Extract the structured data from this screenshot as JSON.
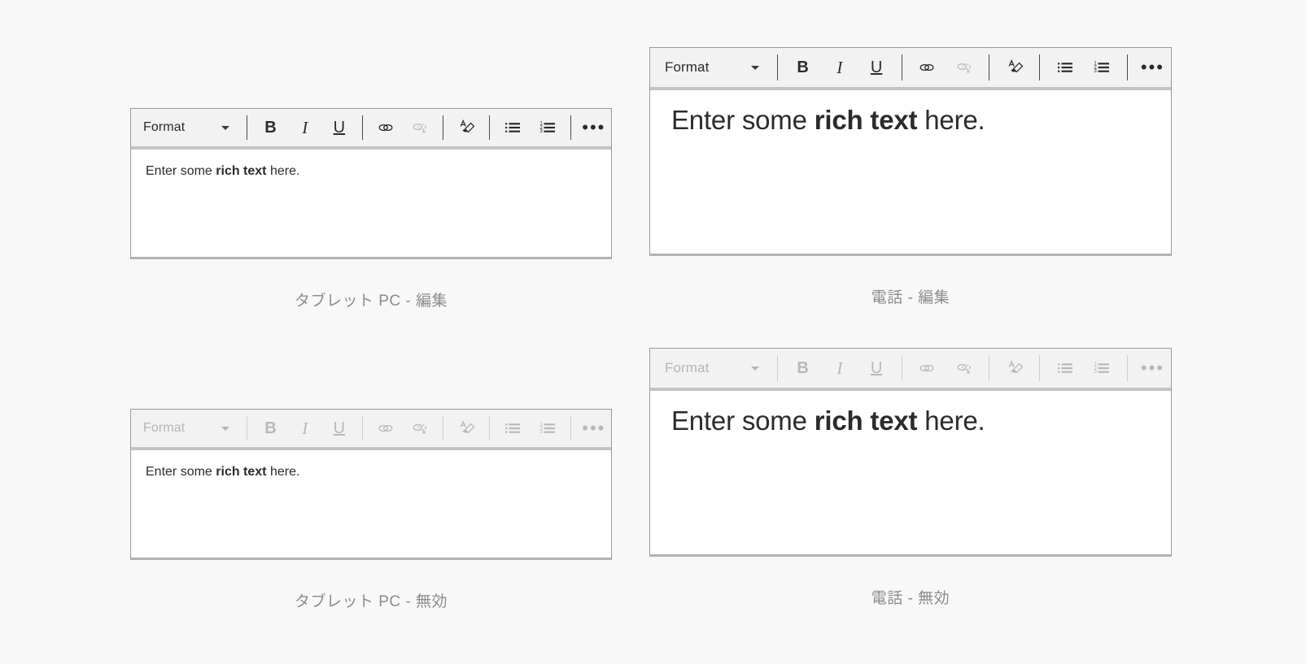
{
  "page": {
    "background_color": "#f8f8f8",
    "caption_color": "#8c8c8c",
    "text_color": "#2b2b2b",
    "toolbar_color": "#f2f2f2",
    "border_color": "#9a9a9a",
    "disabled_color": "#b8b8b8"
  },
  "toolbar": {
    "format_label": "Format",
    "format_dropdown_icon": "chevron-down-icon",
    "buttons": [
      {
        "name": "bold-button",
        "label": "B",
        "icon": "bold-icon"
      },
      {
        "name": "italic-button",
        "label": "I",
        "icon": "italic-icon"
      },
      {
        "name": "underline-button",
        "label": "U",
        "icon": "underline-icon"
      },
      {
        "name": "insert-link-button",
        "label": "",
        "icon": "link-icon"
      },
      {
        "name": "remove-link-button",
        "label": "",
        "icon": "unlink-icon"
      },
      {
        "name": "clear-formatting-button",
        "label": "",
        "icon": "clear-formatting-icon"
      },
      {
        "name": "bulleted-list-button",
        "label": "",
        "icon": "bulleted-list-icon"
      },
      {
        "name": "numbered-list-button",
        "label": "",
        "icon": "numbered-list-icon"
      },
      {
        "name": "more-options-button",
        "label": "•••",
        "icon": "ellipsis-icon"
      }
    ]
  },
  "content": {
    "text_before": "Enter some ",
    "text_bold": "rich text",
    "text_after": " here."
  },
  "panels": [
    {
      "id": "tablet-edit",
      "caption": "タブレット PC - 編集",
      "device": "タブレット PC",
      "state": "編集",
      "disabled": false
    },
    {
      "id": "phone-edit",
      "caption": "電話 - 編集",
      "device": "電話",
      "state": "編集",
      "disabled": false
    },
    {
      "id": "tablet-disabled",
      "caption": "タブレット PC - 無効",
      "device": "タブレット PC",
      "state": "無効",
      "disabled": true
    },
    {
      "id": "phone-disabled",
      "caption": "電話 - 無効",
      "device": "電話",
      "state": "無効",
      "disabled": true
    }
  ]
}
